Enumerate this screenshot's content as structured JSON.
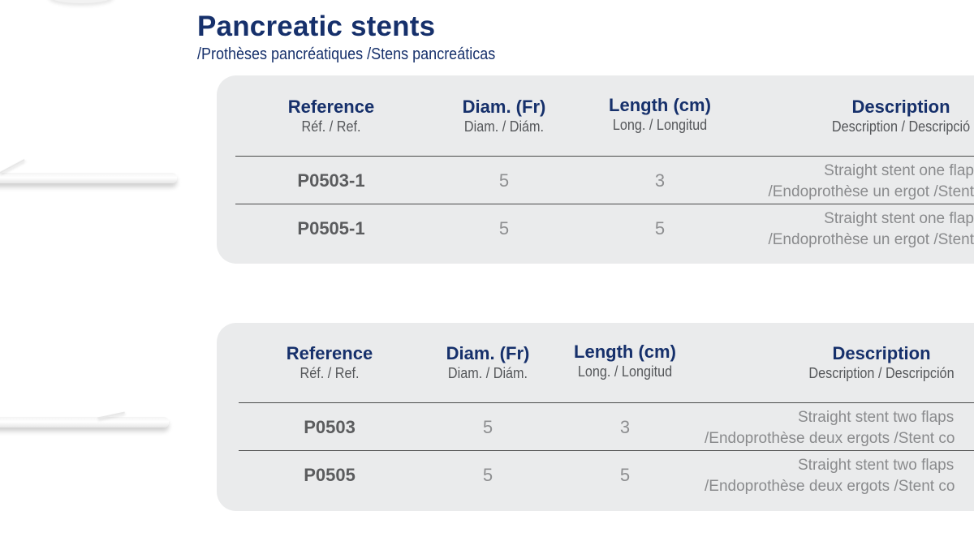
{
  "title": "Pancreatic stents",
  "subtitle": "/Prothèses pancréatiques /Stens pancreáticas",
  "tables": [
    {
      "headers": {
        "reference": {
          "label": "Reference",
          "sub": "Réf. / Ref."
        },
        "diam": {
          "label": "Diam. (Fr)",
          "sub": "Diam. / Diám."
        },
        "length": {
          "label": "Length (cm)",
          "sub": "Long. / Longitud"
        },
        "description": {
          "label": "Description",
          "sub": "Description / Descripció"
        }
      },
      "rows": [
        {
          "ref": "P0503-1",
          "diam": "5",
          "length": "3",
          "desc1": "Straight stent one flap",
          "desc2": "/Endoprothèse un ergot /Stent"
        },
        {
          "ref": "P0505-1",
          "diam": "5",
          "length": "5",
          "desc1": "Straight stent one flap",
          "desc2": "/Endoprothèse un ergot /Stent"
        }
      ]
    },
    {
      "headers": {
        "reference": {
          "label": "Reference",
          "sub": "Réf. / Ref."
        },
        "diam": {
          "label": "Diam. (Fr)",
          "sub": "Diam. / Diám."
        },
        "length": {
          "label": "Length (cm)",
          "sub": "Long. / Longitud"
        },
        "description": {
          "label": "Description",
          "sub": "Description / Descripción"
        }
      },
      "rows": [
        {
          "ref": "P0503",
          "diam": "5",
          "length": "3",
          "desc1": "Straight stent two flaps",
          "desc2": "/Endoprothèse deux ergots /Stent co"
        },
        {
          "ref": "P0505",
          "diam": "5",
          "length": "5",
          "desc1": "Straight stent two flaps",
          "desc2": "/Endoprothèse deux ergots /Stent co"
        }
      ]
    }
  ]
}
